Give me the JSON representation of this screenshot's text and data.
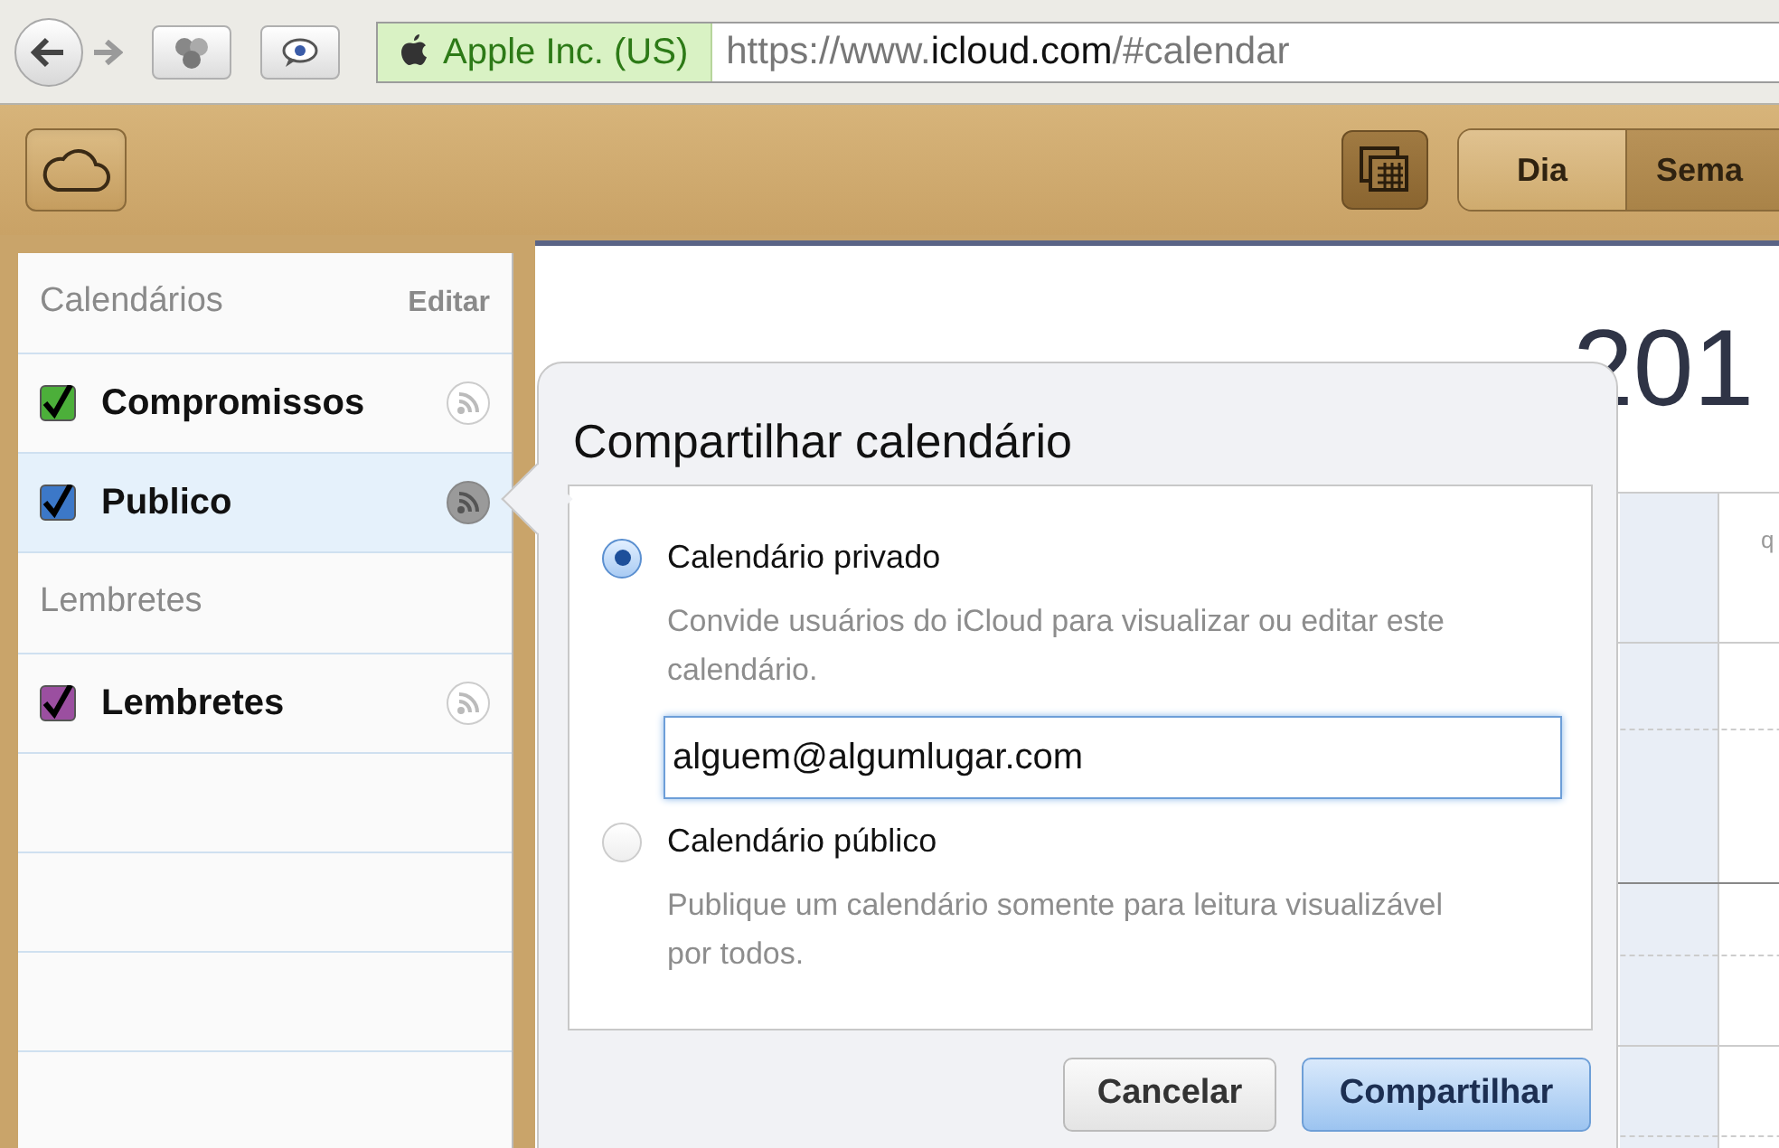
{
  "browser": {
    "identity": "Apple Inc. (US)",
    "url": {
      "scheme": "https://www.",
      "domain": "icloud.com",
      "path": "/#calendar"
    }
  },
  "toolbar": {
    "views": [
      {
        "label": "Dia",
        "selected": false
      },
      {
        "label": "Sema",
        "selected": true
      }
    ]
  },
  "sidebar": {
    "sections": [
      {
        "title": "Calendários",
        "action": "Editar",
        "items": [
          {
            "label": "Compromissos",
            "checked": true,
            "color": "#4caf3a",
            "selected": false
          },
          {
            "label": "Publico",
            "checked": true,
            "color": "#3c78c8",
            "selected": true
          }
        ]
      },
      {
        "title": "Lembretes",
        "items": [
          {
            "label": "Lembretes",
            "checked": true,
            "color": "#9b4fa0",
            "selected": false
          }
        ]
      }
    ]
  },
  "calendar": {
    "heading": "201",
    "column_header": "q"
  },
  "popover": {
    "title": "Compartilhar calendário",
    "options": [
      {
        "label": "Calendário privado",
        "description": "Convide usuários do iCloud para visualizar ou editar este calendário.",
        "selected": true,
        "email": "alguem@algumlugar.com"
      },
      {
        "label": "Calendário público",
        "description": "Publique um calendário somente para leitura visualizável por todos.",
        "selected": false
      }
    ],
    "buttons": [
      {
        "label": "Cancelar",
        "kind": "secondary"
      },
      {
        "label": "Compartilhar",
        "kind": "primary"
      }
    ]
  }
}
